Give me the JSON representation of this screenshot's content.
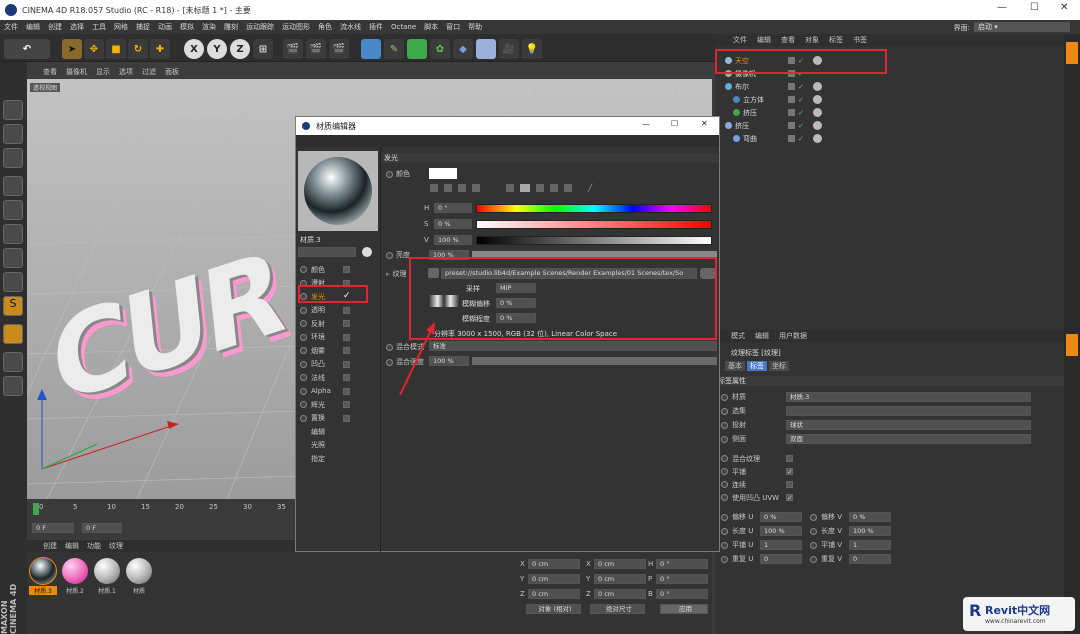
{
  "window": {
    "title": "CINEMA 4D R18.057 Studio (RC - R18) - [未标题 1 *] - 主要"
  },
  "menu": [
    "文件",
    "编辑",
    "创建",
    "选择",
    "工具",
    "网格",
    "捕捉",
    "动画",
    "模拟",
    "渲染",
    "雕刻",
    "运动跟踪",
    "运动图形",
    "角色",
    "流水线",
    "插件",
    "Octane",
    "脚本",
    "窗口",
    "帮助"
  ],
  "layout": {
    "label": "界面:",
    "value": "启动"
  },
  "viewport": {
    "menu": [
      "查看",
      "摄像机",
      "显示",
      "选项",
      "过滤",
      "面板"
    ],
    "camera_label": "透视视图",
    "text3d": "CUR"
  },
  "timeline": {
    "ticks": [
      "0",
      "5",
      "10",
      "15",
      "20",
      "25",
      "30",
      "35"
    ],
    "frame_field": "0 F",
    "frame_field2": "0 F"
  },
  "material_panel": {
    "menu": [
      "创建",
      "编辑",
      "功能",
      "纹理"
    ],
    "materials": [
      {
        "name": "材质.3",
        "active": true
      },
      {
        "name": "材质.2",
        "active": false
      },
      {
        "name": "材质.1",
        "active": false
      },
      {
        "name": "材质",
        "active": false
      }
    ]
  },
  "coords": {
    "rows": [
      {
        "a": "X",
        "av": "0 cm",
        "b": "X",
        "bv": "0 cm",
        "c": "H",
        "cv": "0 °"
      },
      {
        "a": "Y",
        "av": "0 cm",
        "b": "Y",
        "bv": "0 cm",
        "c": "P",
        "cv": "0 °"
      },
      {
        "a": "Z",
        "av": "0 cm",
        "b": "Z",
        "bv": "0 cm",
        "c": "B",
        "cv": "0 °"
      }
    ],
    "mode1": "对象 (相对)",
    "mode2": "绝对尺寸",
    "apply": "应用"
  },
  "object_manager": {
    "menu": [
      "文件",
      "编辑",
      "查看",
      "对象",
      "标签",
      "书签"
    ],
    "objects": [
      {
        "name": "天空",
        "indent": 0,
        "highlight": true
      },
      {
        "name": "摄像机",
        "indent": 0,
        "highlight": false
      },
      {
        "name": "布尔",
        "indent": 0,
        "highlight": false
      },
      {
        "name": "立方体",
        "indent": 1,
        "highlight": false
      },
      {
        "name": "挤压",
        "indent": 1,
        "highlight": false
      },
      {
        "name": "挤压",
        "indent": 0,
        "highlight": false
      },
      {
        "name": "弯曲",
        "indent": 1,
        "highlight": false
      }
    ]
  },
  "attribute_manager": {
    "menu": [
      "模式",
      "编辑",
      "用户数据"
    ],
    "header": "纹理标签 [纹理]",
    "tabs": [
      "基本",
      "标签",
      "坐标"
    ],
    "section": "标签属性",
    "rows": [
      {
        "label": "材质",
        "value": "材质.3"
      },
      {
        "label": "选集",
        "value": ""
      },
      {
        "label": "投射",
        "value": "球状"
      },
      {
        "label": "侧面",
        "value": "双面"
      }
    ],
    "checks": [
      {
        "label": "混合纹理",
        "checked": false
      },
      {
        "label": "平铺",
        "checked": true
      },
      {
        "label": "连续",
        "checked": false
      },
      {
        "label": "使用凹凸 UVW",
        "checked": true
      }
    ],
    "offsets": [
      {
        "l1": "偏移 U",
        "v1": "0 %",
        "l2": "偏移 V",
        "v2": "0 %"
      },
      {
        "l1": "长度 U",
        "v1": "100 %",
        "l2": "长度 V",
        "v2": "100 %"
      },
      {
        "l1": "平铺 U",
        "v1": "1",
        "l2": "平铺 V",
        "v2": "1"
      },
      {
        "l1": "重复 U",
        "v1": "0",
        "l2": "重复 V",
        "v2": "0"
      }
    ]
  },
  "material_editor": {
    "title": "材质编辑器",
    "material_name": "材质.3",
    "channels": [
      {
        "label": "颜色",
        "checked": false
      },
      {
        "label": "漫射",
        "checked": false
      },
      {
        "label": "发光",
        "checked": true
      },
      {
        "label": "透明",
        "checked": false
      },
      {
        "label": "反射",
        "checked": false
      },
      {
        "label": "环境",
        "checked": false
      },
      {
        "label": "烟雾",
        "checked": false
      },
      {
        "label": "凹凸",
        "checked": false
      },
      {
        "label": "法线",
        "checked": false
      },
      {
        "label": "Alpha",
        "checked": false
      },
      {
        "label": "辉光",
        "checked": false
      },
      {
        "label": "置换",
        "checked": false
      },
      {
        "label": "编辑",
        "checked": null
      },
      {
        "label": "光照",
        "checked": null
      },
      {
        "label": "指定",
        "checked": null
      }
    ],
    "section": "发光",
    "color_label": "颜色",
    "hsv": [
      {
        "label": "H",
        "value": "0 °"
      },
      {
        "label": "S",
        "value": "0 %"
      },
      {
        "label": "V",
        "value": "100 %"
      }
    ],
    "brightness": {
      "label": "亮度",
      "value": "100 %"
    },
    "texture": {
      "label": "纹理",
      "path": "preset://studio.lib4d/Example Scenes/Render Examples/01 Scenes/tex/So"
    },
    "sampling": {
      "label": "采样",
      "value": "MIP"
    },
    "blur_offset": {
      "label": "模糊偏移",
      "value": "0 %"
    },
    "blur_scale": {
      "label": "模糊程度",
      "value": "0 %"
    },
    "resolution": "分辨率 3000 x 1500, RGB (32 位), Linear Color Space",
    "blend_mode": {
      "label": "混合模式",
      "value": "标准"
    },
    "blend_strength": {
      "label": "混合强度",
      "value": "100 %"
    }
  },
  "watermark": {
    "brand": "Revit中文网",
    "url": "www.chinarevit.com"
  },
  "maxon": "MAXON CINEMA 4D",
  "colors": {
    "accent": "#ee8a13",
    "red_annotation": "#e0262e"
  }
}
